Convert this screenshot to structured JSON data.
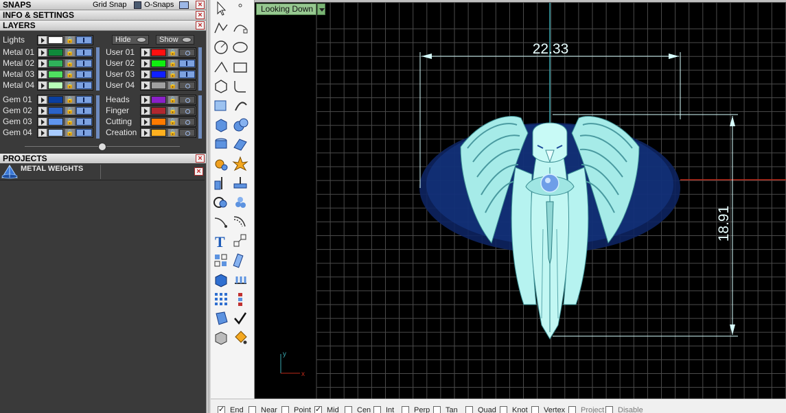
{
  "sections": {
    "snaps": "SNAPS",
    "grid_snap": "Grid Snap",
    "o_snaps": "O-Snaps",
    "info_settings": "INFO & SETTINGS",
    "layers": "LAYERS",
    "projects": "PROJECTS"
  },
  "layers": {
    "lights_label": "Lights",
    "hide_label": "Hide",
    "show_label": "Show",
    "left_group1": [
      {
        "name": "Metal 01",
        "color": "#0f8a3a"
      },
      {
        "name": "Metal 02",
        "color": "#2fb25a"
      },
      {
        "name": "Metal 03",
        "color": "#4fe060"
      },
      {
        "name": "Metal 04",
        "color": "#b8ffb8"
      }
    ],
    "right_group1": [
      {
        "name": "User 01",
        "color": "#ff1010"
      },
      {
        "name": "User 02",
        "color": "#10ee10"
      },
      {
        "name": "User 03",
        "color": "#1020ff"
      },
      {
        "name": "User 04",
        "color": "#a0a0a0"
      }
    ],
    "left_group2": [
      {
        "name": "Gem 01",
        "color": "#0a3fa0"
      },
      {
        "name": "Gem 02",
        "color": "#2b63c8"
      },
      {
        "name": "Gem 03",
        "color": "#5f95ee"
      },
      {
        "name": "Gem 04",
        "color": "#a8cbff"
      }
    ],
    "right_group2": [
      {
        "name": "Heads",
        "color": "#8a20c8"
      },
      {
        "name": "Finger",
        "color": "#b02830"
      },
      {
        "name": "Cutting",
        "color": "#ff7a00"
      },
      {
        "name": "Creation",
        "color": "#ffb020"
      }
    ]
  },
  "projects": {
    "item_label": "METAL WEIGHTS",
    "item_icon": "metal-weights-icon"
  },
  "viewport": {
    "view_name": "Looking Down",
    "dim_width": "22.33",
    "dim_height": "18.91",
    "axis_y": "y",
    "axis_x": "x",
    "model": "eagle-pendant"
  },
  "toolbar_icons": [
    "select-arrow-icon",
    "point-icon",
    "polyline-icon",
    "curve-points-icon",
    "circle-icon",
    "ellipse-icon",
    "arc-icon",
    "rectangle-icon",
    "polygon-icon",
    "fillet-curve-icon",
    "cage-edit-icon",
    "revolve-icon",
    "box-icon",
    "sphere-icon",
    "cylinder-icon",
    "surface-icon",
    "gear-settings-icon",
    "burst-icon",
    "split-icon",
    "trim-icon",
    "boolean-icon",
    "cluster-icon",
    "curve-tool-icon",
    "offset-curve-icon",
    "text-icon",
    "scale-icon",
    "array-icon",
    "ruler-icon",
    "solid-box-icon",
    "pipe-icon",
    "grid-array-icon",
    "sequence-icon",
    "gem-icon",
    "checkmark-icon",
    "cube-shade-icon",
    "paint-bucket-icon"
  ],
  "osnaps": [
    {
      "label": "End",
      "checked": true
    },
    {
      "label": "Near",
      "checked": false
    },
    {
      "label": "Point",
      "checked": false
    },
    {
      "label": "Mid",
      "checked": true
    },
    {
      "label": "Cen",
      "checked": false
    },
    {
      "label": "Int",
      "checked": false
    },
    {
      "label": "Perp",
      "checked": false
    },
    {
      "label": "Tan",
      "checked": false
    },
    {
      "label": "Quad",
      "checked": false
    },
    {
      "label": "Knot",
      "checked": false
    },
    {
      "label": "Vertex",
      "checked": false
    },
    {
      "label": "Project",
      "checked": false,
      "disabled": true
    },
    {
      "label": "Disable",
      "checked": false,
      "disabled": true
    }
  ],
  "colors": {
    "grid_line": "#4b4b4b",
    "dimension": "#d8ffff",
    "model": "#aef2ee",
    "model_shadow": "#12307a",
    "view_label_bg": "#96c890"
  }
}
